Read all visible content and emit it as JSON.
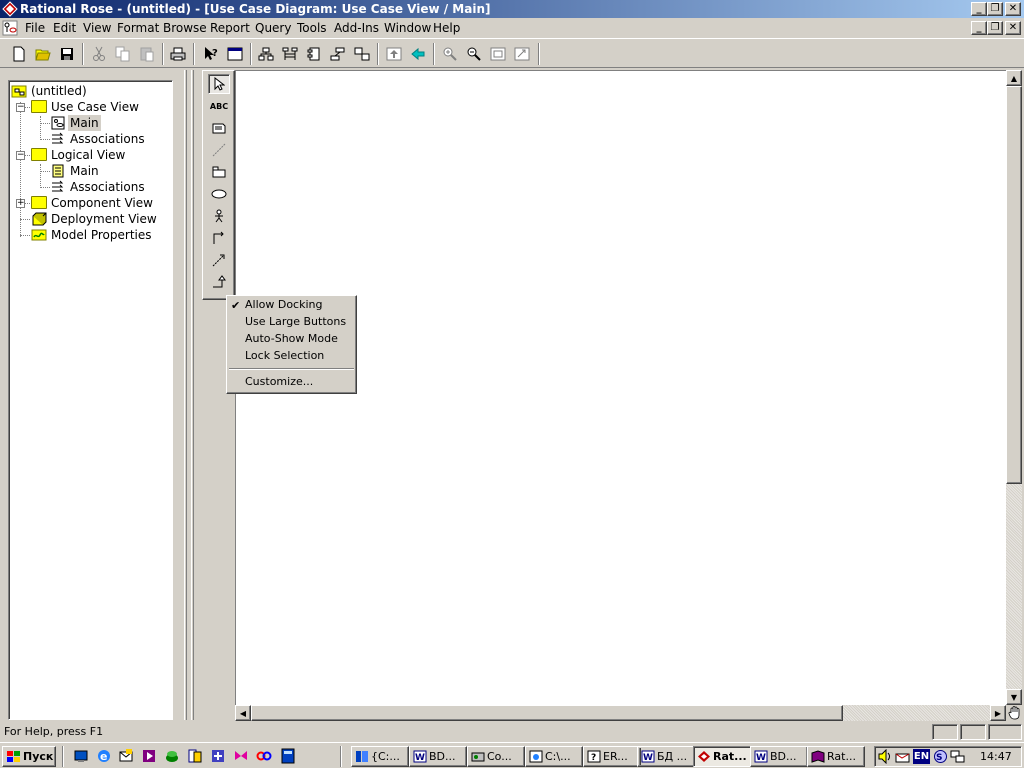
{
  "window": {
    "title": "Rational Rose - (untitled) - [Use Case Diagram: Use Case View / Main]",
    "minimize_glyph": "_",
    "restore_glyph": "❐",
    "close_glyph": "✕"
  },
  "menubar": {
    "items": [
      "File",
      "Edit",
      "View",
      "Format",
      "Browse",
      "Report",
      "Query",
      "Tools",
      "Add-Ins",
      "Window",
      "Help"
    ]
  },
  "toolbar": {
    "icons": [
      "new-icon",
      "open-icon",
      "save-icon",
      "cut-icon",
      "copy-icon",
      "paste-icon",
      "print-icon",
      "context-help-icon",
      "view-doc-icon",
      "browse-class-diagram-icon",
      "browse-interaction-diagram-icon",
      "browse-component-diagram-icon",
      "browse-deployment-diagram-icon",
      "browse-parent-icon",
      "browse-previous-icon",
      "zoom-in-icon",
      "zoom-out-icon",
      "fit-in-window-icon",
      "undo-fit-icon"
    ]
  },
  "tree": {
    "root": "(untitled)",
    "use_case_view": "Use Case View",
    "use_case_main": "Main",
    "use_case_associations": "Associations",
    "logical_view": "Logical View",
    "logical_main": "Main",
    "logical_associations": "Associations",
    "component_view": "Component View",
    "deployment_view": "Deployment View",
    "model_properties": "Model Properties",
    "collapse_glyph": "−",
    "expand_glyph": "+"
  },
  "toolbox": {
    "tools": [
      "selection-tool-icon",
      "text-box-tool-icon",
      "note-tool-icon",
      "anchor-note-tool-icon",
      "package-tool-icon",
      "use-case-tool-icon",
      "actor-tool-icon",
      "unidirectional-association-tool-icon",
      "dependency-tool-icon",
      "generalization-tool-icon"
    ],
    "text_tool_label": "ABC"
  },
  "context_menu": {
    "items": [
      {
        "label": "Allow  Docking",
        "checked": true
      },
      {
        "label": "Use Large Buttons",
        "checked": false
      },
      {
        "label": "Auto-Show Mode",
        "checked": false
      },
      {
        "label": "Lock Selection",
        "checked": false
      }
    ],
    "customize": "Customize...",
    "check_glyph": "✔"
  },
  "statusbar": {
    "text": "For Help, press F1"
  },
  "taskbar": {
    "start_label": "Пуск",
    "tasks": [
      {
        "label": "{C:...",
        "icon": "folder-icon"
      },
      {
        "label": "BD...",
        "icon": "word-icon"
      },
      {
        "label": "Co...",
        "icon": "control-panel-icon"
      },
      {
        "label": "C:\\...",
        "icon": "explorer-icon"
      },
      {
        "label": "ER...",
        "icon": "help-icon"
      },
      {
        "label": "БД ...",
        "icon": "word-icon"
      },
      {
        "label": "Rat...",
        "icon": "rational-rose-icon",
        "active": true
      },
      {
        "label": "BD...",
        "icon": "word-icon"
      },
      {
        "label": "Rat...",
        "icon": "book-icon"
      }
    ],
    "language": "EN",
    "clock": "14:47"
  },
  "colors": {
    "titlebar_start": "#0a246a",
    "titlebar_end": "#a6caf0",
    "face": "#d4d0c8",
    "folder": "#ffff00",
    "active_task": "#ece9e2"
  }
}
